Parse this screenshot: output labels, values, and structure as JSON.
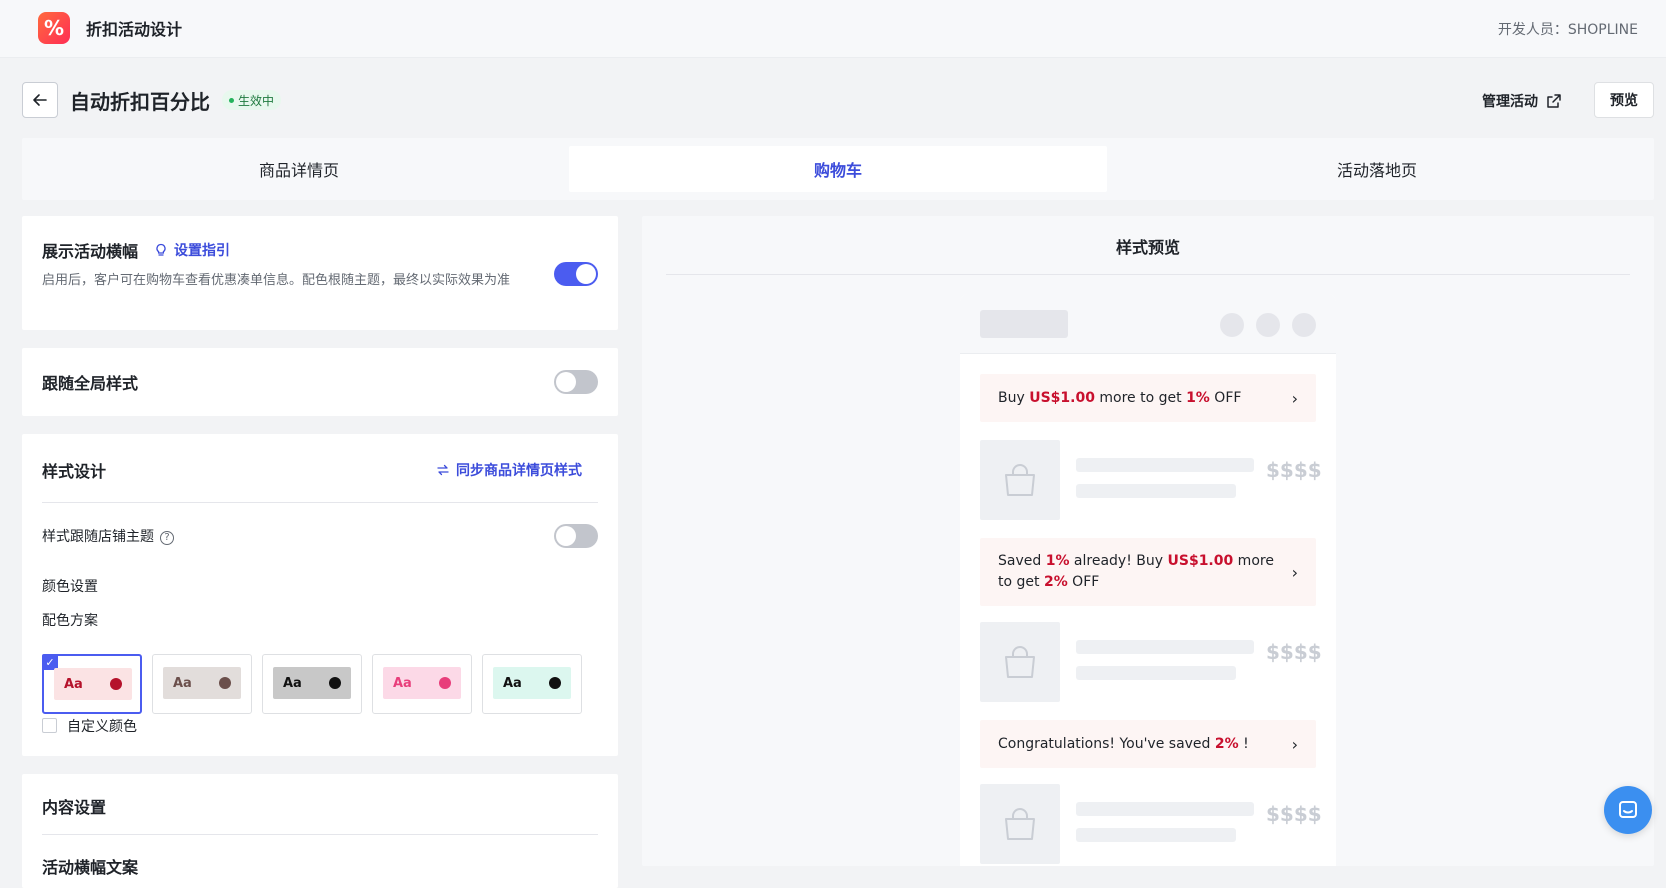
{
  "app": {
    "title": "折扣活动设计",
    "developer": "开发人员：SHOPLINE",
    "logo_glyph": "%"
  },
  "header": {
    "title": "自动折扣百分比",
    "status": "生效中",
    "manage_label": "管理活动",
    "preview_label": "预览"
  },
  "tabs": [
    {
      "label": "商品详情页",
      "active": false
    },
    {
      "label": "购物车",
      "active": true
    },
    {
      "label": "活动落地页",
      "active": false
    }
  ],
  "banner_settings": {
    "title": "展示活动横幅",
    "guide_label": "设置指引",
    "description": "启用后，客户可在购物车查看优惠凑单信息。配色根随主题，最终以实际效果为准",
    "enabled": true
  },
  "global_style": {
    "title": "跟随全局样式",
    "enabled": false
  },
  "style_design": {
    "title": "样式设计",
    "sync_label": "同步商品详情页样式",
    "follow_theme_label": "样式跟随店铺主题",
    "follow_theme_enabled": false,
    "color_settings_label": "颜色设置",
    "scheme_label": "配色方案",
    "schemes": [
      {
        "text": "Aa",
        "bg": "#fbe3e4",
        "dot": "#b5122b",
        "text_color": "#b5122b",
        "selected": true
      },
      {
        "text": "Aa",
        "bg": "#e2dddb",
        "dot": "#6b4f4b",
        "text_color": "#6b4f4b",
        "selected": false
      },
      {
        "text": "Aa",
        "bg": "#c8c8c8",
        "dot": "#111111",
        "text_color": "#111111",
        "selected": false
      },
      {
        "text": "Aa",
        "bg": "#fcd9e7",
        "dot": "#e83e7b",
        "text_color": "#e83e7b",
        "selected": false
      },
      {
        "text": "Aa",
        "bg": "#dcf7ef",
        "dot": "#111111",
        "text_color": "#111111",
        "selected": false
      }
    ],
    "custom_color_label": "自定义颜色"
  },
  "content_settings": {
    "title": "内容设置",
    "banner_copy_label": "活动横幅文案"
  },
  "preview": {
    "title": "样式预览",
    "banners": [
      {
        "p1": "Buy ",
        "h1": "US$1.00",
        "p2": " more to get ",
        "h2": "1%",
        "p3": " OFF"
      },
      {
        "p1": "Saved ",
        "h1": "1%",
        "p2": " already! Buy ",
        "h2": "US$1.00",
        "p3": " more to get ",
        "h3": "2%",
        "p4": " OFF"
      },
      {
        "p1": "Congratulations! You've saved ",
        "h1": "2%",
        "p2": " !"
      }
    ],
    "price_placeholder": "$$$$"
  },
  "colors": {
    "accent": "#4b5cf0",
    "highlight": "#c8102e",
    "banner_bg": "#fdf5f4",
    "status_bg": "#e8f8ee"
  }
}
